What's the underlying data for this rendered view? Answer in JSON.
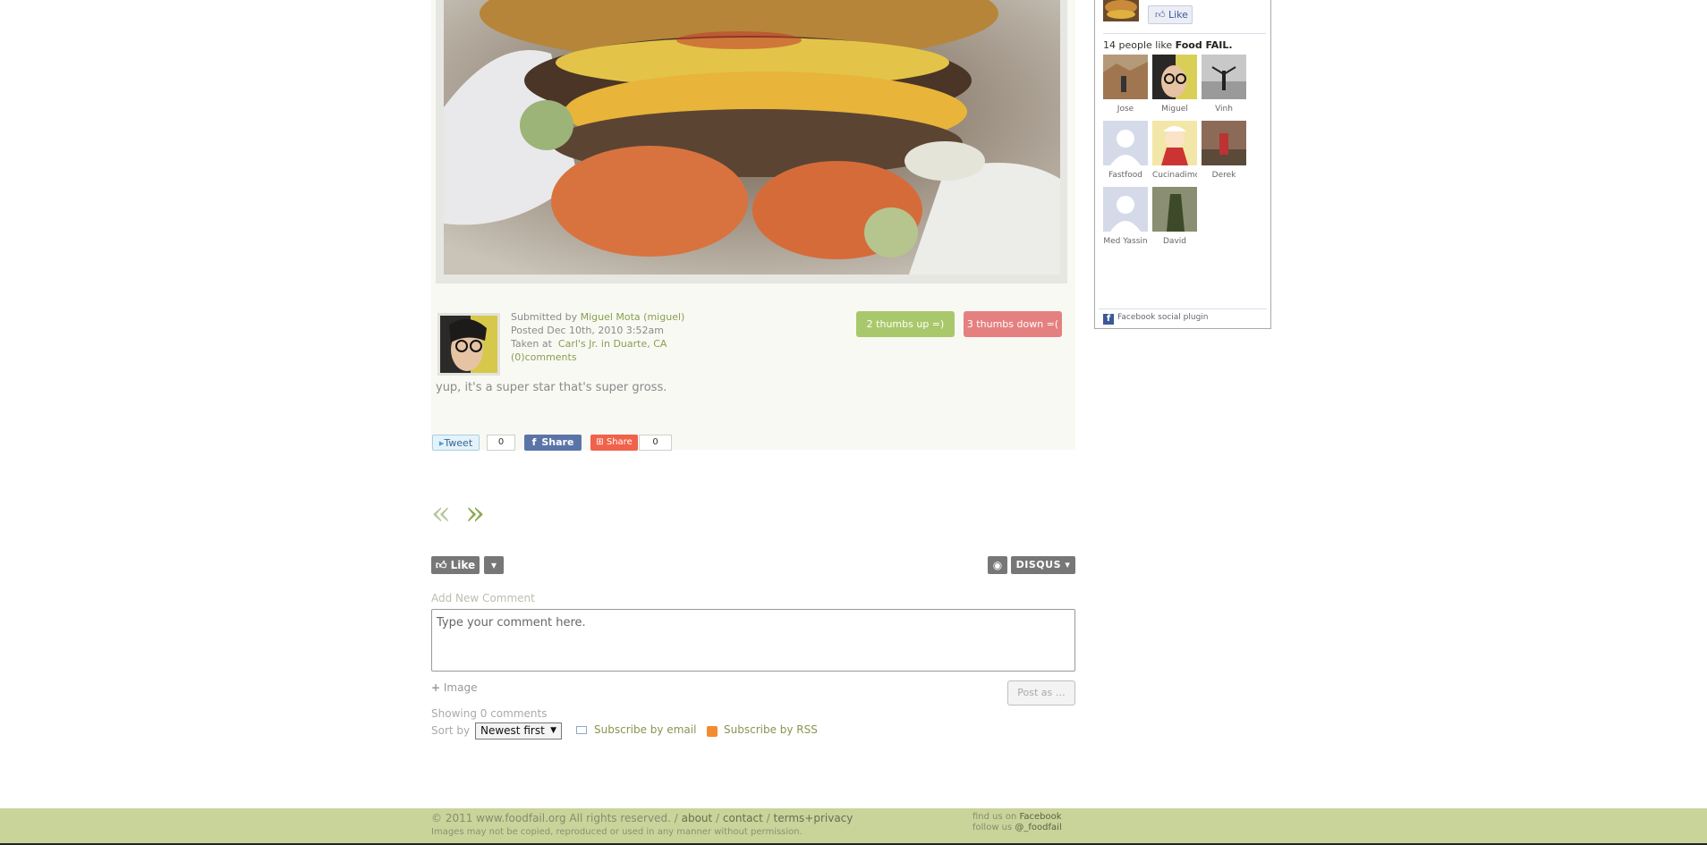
{
  "post": {
    "submitted_label": "Submitted by",
    "submitter": "Miguel Mota (miguel)",
    "posted": "Posted Dec 10th, 2010 3:52am",
    "taken_at_label": "Taken at",
    "location": "Carl's Jr. in Duarte, CA",
    "comments_link": "(0)comments",
    "caption": "yup, it's a super star that's super gross.",
    "thumbs_up": "2 thumbs up =)",
    "thumbs_down": "3 thumbs down =("
  },
  "share": {
    "tweet_label": "Tweet",
    "tweet_count": "0",
    "fb_share_label": "Share",
    "share_label": "Share",
    "share_count": "0"
  },
  "pager": {
    "prev": "«",
    "next": "»"
  },
  "disqus": {
    "like_label": "Like",
    "brand": "DISQUS ▾",
    "add_comment_label": "Add New Comment",
    "comment_placeholder": "Type your comment here.",
    "image_label": "Image",
    "post_as_label": "Post as …",
    "showing_label": "Showing 0 comments",
    "sort_label": "Sort by",
    "sort_value": "Newest first",
    "subscribe_email": "Subscribe by email",
    "subscribe_rss": "Subscribe by RSS"
  },
  "footer": {
    "copyright": "© 2011 www.foodfail.org All rights reserved. /",
    "about": "about",
    "sep1": "/",
    "contact": "contact",
    "sep2": "/",
    "terms": "terms+privacy",
    "disclaimer": "Images may not be copied, reproduced or used in any manner without permission.",
    "find_us_prefix": "find us on",
    "find_us_link": "Facebook",
    "follow_prefix": "follow us",
    "follow_link": "@_foodfail"
  },
  "facebook": {
    "like_label": "Like",
    "count_text": "14 people like",
    "page_name": "Food FAIL.",
    "plugin_label": "Facebook social plugin",
    "fans": [
      {
        "name": "Jose",
        "color": "#a08868"
      },
      {
        "name": "Miguel",
        "color": "#cfc85a"
      },
      {
        "name": "Vinh",
        "color": "#b8b8b8"
      },
      {
        "name": "Fastfood",
        "color": "#d4dae8"
      },
      {
        "name": "Cucinadimc",
        "color": "#e6d07a"
      },
      {
        "name": "Derek",
        "color": "#8a5a48"
      },
      {
        "name": "Med Yassin",
        "color": "#d4dae8"
      },
      {
        "name": "David",
        "color": "#7d8266"
      }
    ]
  },
  "colors": {
    "accent_green": "#a9c86b",
    "accent_red": "#e58080",
    "footer_bg": "#c8d49a",
    "facebook_blue": "#3b5998"
  }
}
